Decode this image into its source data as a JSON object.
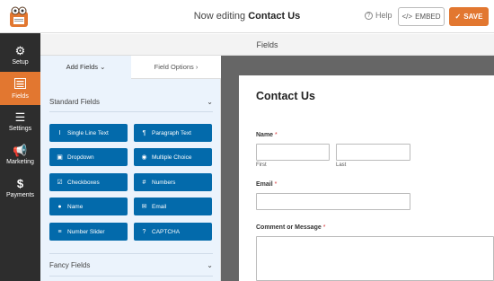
{
  "header": {
    "title_prefix": "Now editing",
    "title_form": "Contact Us",
    "help_label": "Help",
    "embed_label": "EMBED",
    "save_label": "SAVE"
  },
  "sidebar": {
    "items": [
      {
        "label": "Setup",
        "icon": "gear-icon"
      },
      {
        "label": "Fields",
        "icon": "fields-icon"
      },
      {
        "label": "Settings",
        "icon": "sliders-icon"
      },
      {
        "label": "Marketing",
        "icon": "megaphone-icon"
      },
      {
        "label": "Payments",
        "icon": "dollar-icon"
      }
    ],
    "active": "Fields"
  },
  "fields_header": "Fields",
  "panel": {
    "tabs": {
      "add": "Add Fields",
      "options": "Field Options"
    },
    "standard_title": "Standard Fields",
    "fancy_title": "Fancy Fields",
    "standard_fields": [
      {
        "label": "Single Line Text",
        "icon": "text-cursor-icon"
      },
      {
        "label": "Paragraph Text",
        "icon": "paragraph-icon"
      },
      {
        "label": "Dropdown",
        "icon": "dropdown-icon"
      },
      {
        "label": "Multiple Choice",
        "icon": "radio-icon"
      },
      {
        "label": "Checkboxes",
        "icon": "checkbox-icon"
      },
      {
        "label": "Numbers",
        "icon": "hash-icon"
      },
      {
        "label": "Name",
        "icon": "user-icon"
      },
      {
        "label": "Email",
        "icon": "envelope-icon"
      },
      {
        "label": "Number Slider",
        "icon": "slider-icon"
      },
      {
        "label": "CAPTCHA",
        "icon": "question-icon"
      }
    ]
  },
  "form": {
    "title": "Contact Us",
    "name_label": "Name",
    "first_sublabel": "First",
    "last_sublabel": "Last",
    "email_label": "Email",
    "message_label": "Comment or Message",
    "required_marker": "*"
  },
  "colors": {
    "accent": "#e27730",
    "field_button": "#036aab",
    "sidebar": "#2d2d2d"
  }
}
